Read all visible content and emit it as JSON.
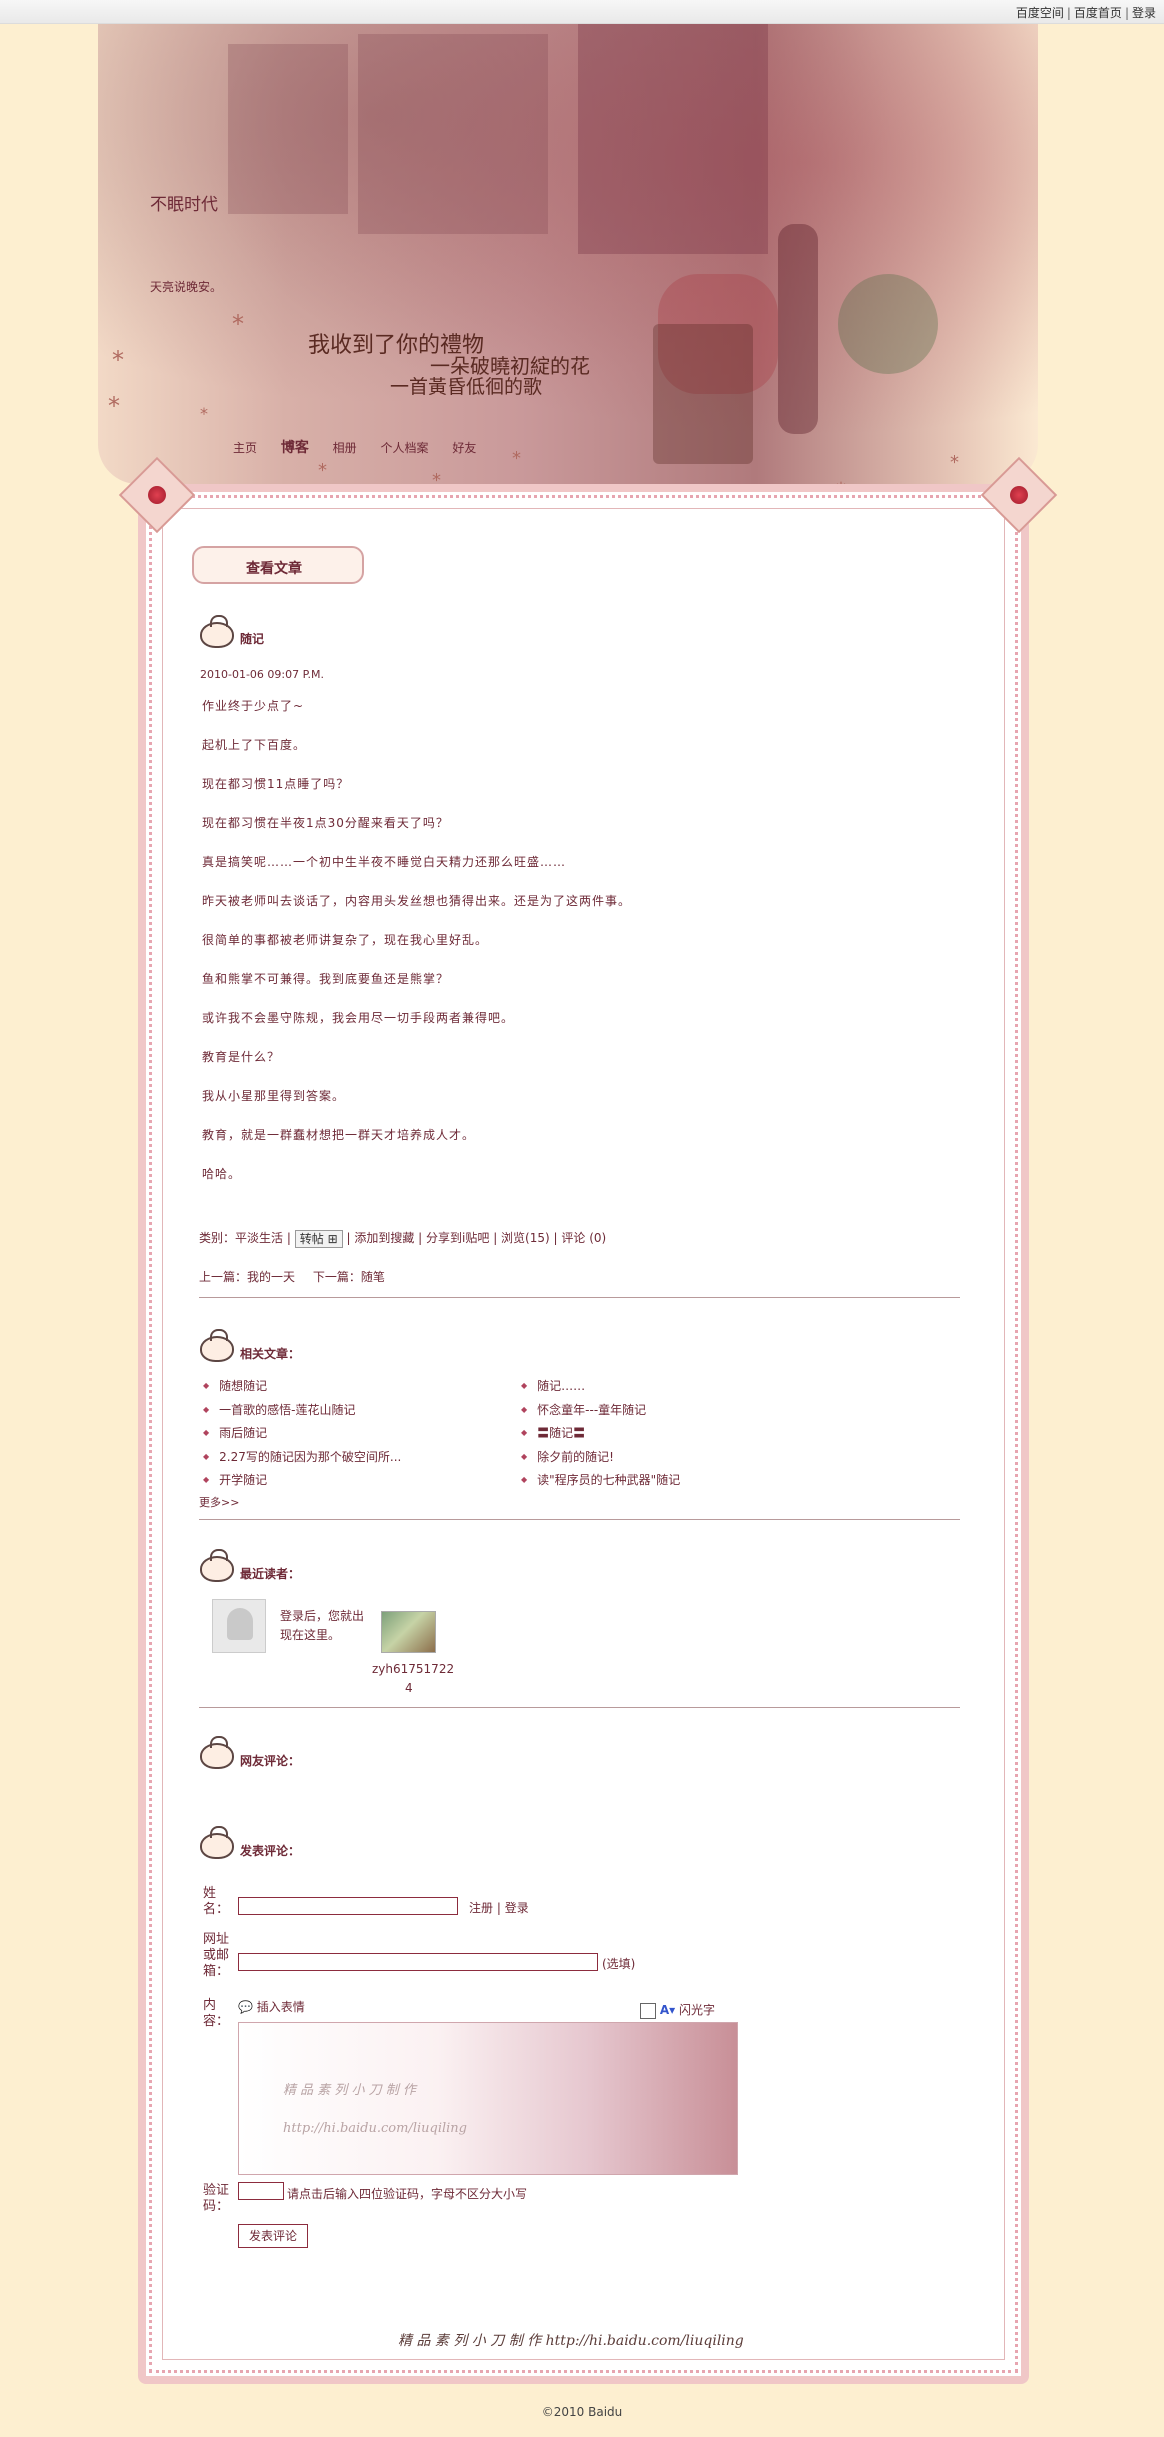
{
  "topbar": {
    "link1": "百度空间",
    "link2": "百度首页",
    "link3": "登录",
    "sep": "|"
  },
  "banner": {
    "title": "不眠时代",
    "subtitle": "天亮说晚安。",
    "poem_line1": "我收到了你的禮物",
    "poem_line2": "一朵破曉初綻的花",
    "poem_line3": "一首黃昏低徊的歌"
  },
  "nav": {
    "home": "主页",
    "blog": "博客",
    "album": "相册",
    "profile": "个人档案",
    "friends": "好友"
  },
  "view_article": "查看文章",
  "article": {
    "title": "随记",
    "date": "2010-01-06 09:07 P.M.",
    "paragraphs": [
      "作业终于少点了~",
      "起机上了下百度。",
      "现在都习惯11点睡了吗？",
      "现在都习惯在半夜1点30分醒来看天了吗？",
      "真是搞笑呢……一个初中生半夜不睡觉白天精力还那么旺盛……",
      "昨天被老师叫去谈话了，内容用头发丝想也猜得出来。还是为了这两件事。",
      "很简单的事都被老师讲复杂了，现在我心里好乱。",
      "鱼和熊掌不可兼得。我到底要鱼还是熊掌？",
      "或许我不会墨守陈规，我会用尽一切手段两者兼得吧。",
      "教育是什么？",
      "我从小星那里得到答案。",
      "教育，就是一群蠢材想把一群天才培养成人才。",
      "哈哈。"
    ],
    "category_label": "类别：",
    "category": "平淡生活",
    "zhuantie": "转帖",
    "add_bookmark": "添加到搜藏",
    "share": "分享到i贴吧",
    "views": "浏览(15)",
    "comments": "评论 (0)",
    "prev_label": "上一篇：",
    "prev": "我的一天",
    "next_label": "下一篇：",
    "next": "随笔"
  },
  "related": {
    "title": "相关文章：",
    "left": [
      "随想随记",
      "一首歌的感悟-莲花山随记",
      "雨后随记",
      "2.27写的随记因为那个破空间所...",
      "开学随记"
    ],
    "right": [
      "随记……",
      "怀念童年---童年随记",
      "〓随记〓",
      "除夕前的随记!",
      "读\"程序员的七种武器\"随记"
    ],
    "more": "更多>>"
  },
  "readers": {
    "title": "最近读者：",
    "login_hint_1": "登录后，您就出",
    "login_hint_2": "现在这里。",
    "reader_name_1": "zyh61751722",
    "reader_name_2": "4"
  },
  "comments_section": {
    "title": "网友评论："
  },
  "post_comment": {
    "title": "发表评论：",
    "name_label": "姓名：",
    "register": "注册",
    "login": "登录",
    "url_label": "网址或邮箱：",
    "optional": "(选填)",
    "content_label": "内容：",
    "insert_emoji": "插入表情",
    "flash_text": "闪光字",
    "editor_sig_1": "精 品 素 列   小 刀 制 作",
    "editor_sig_2": "http://hi.baidu.com/liuqiling",
    "captcha_label": "验证码：",
    "captcha_hint": "请点击后输入四位验证码，字母不区分大小写",
    "submit": "发表评论"
  },
  "footer": {
    "signature": "精 品 素 列   小 刀 制 作     http://hi.baidu.com/liuqiling",
    "copyright": "©2010 Baidu"
  },
  "colors": {
    "page_bg": "#fdefd0",
    "text": "#6a2d33",
    "accent": "#b0435d"
  }
}
